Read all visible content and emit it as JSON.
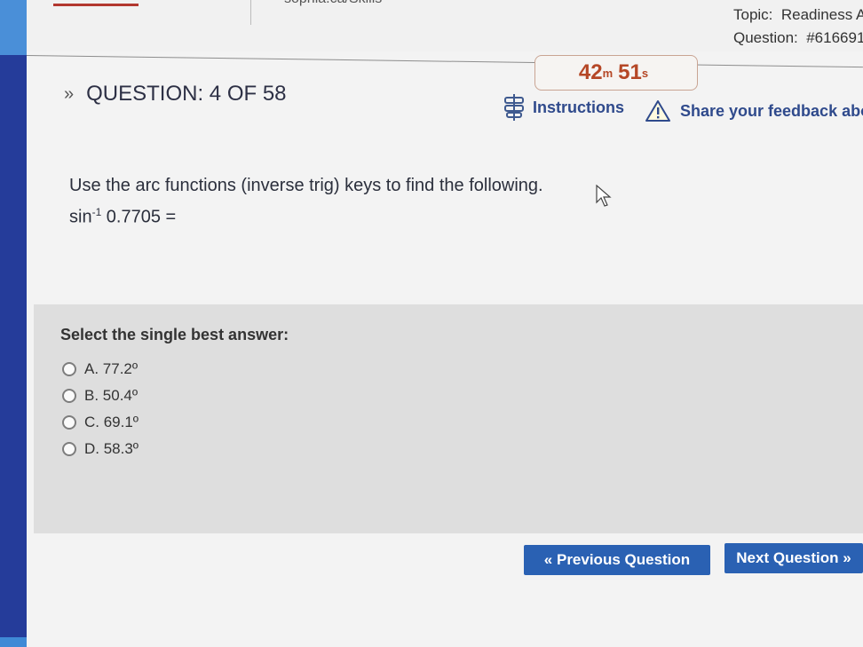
{
  "header": {
    "cut_title": "sophia.ca/Skills",
    "topic_label": "Topic:",
    "topic_value": "Readiness A",
    "question_label": "Question:",
    "question_value": "#616691"
  },
  "timer": {
    "minutes": "42",
    "min_unit": "m",
    "seconds": "51",
    "sec_unit": "s"
  },
  "question": {
    "heading": "QUESTION: 4 OF 58",
    "prompt": "Use the arc functions (inverse trig) keys to find the following.",
    "expr_fn": "sin",
    "expr_sup": "-1",
    "expr_value": " 0.7705 ="
  },
  "toolbar": {
    "instructions_label": "Instructions",
    "feedback_label": "Share your feedback abo"
  },
  "answers": {
    "label": "Select the single best answer:",
    "options": [
      "A. 77.2º",
      "B. 50.4º",
      "C. 69.1º",
      "D. 58.3º"
    ]
  },
  "nav": {
    "prev_label": "« Previous Question",
    "next_label": "Next Question »"
  },
  "colors": {
    "accent": "#2a61b3",
    "timer": "#b54726",
    "link": "#2f4a8c",
    "sidebar": "#253c9a"
  }
}
